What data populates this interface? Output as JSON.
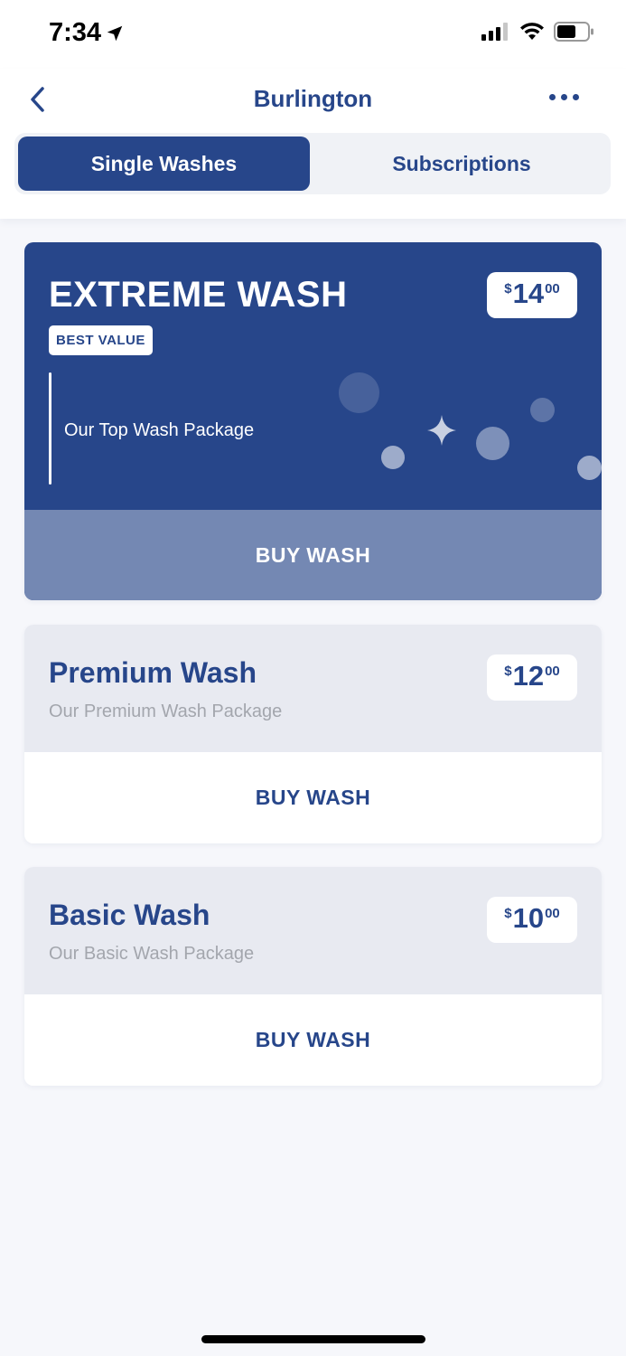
{
  "status_bar": {
    "time": "7:34"
  },
  "header": {
    "title": "Burlington",
    "tabs": [
      {
        "label": "Single Washes",
        "active": true
      },
      {
        "label": "Subscriptions",
        "active": false
      }
    ]
  },
  "washes": [
    {
      "name": "EXTREME WASH",
      "badge": "BEST VALUE",
      "description": "Our Top Wash Package",
      "price": {
        "currency": "$",
        "dollars": "14",
        "cents": "00"
      },
      "button_label": "BUY WASH"
    },
    {
      "name": "Premium Wash",
      "description": "Our Premium Wash Package",
      "price": {
        "currency": "$",
        "dollars": "12",
        "cents": "00"
      },
      "button_label": "BUY WASH"
    },
    {
      "name": "Basic Wash",
      "description": "Our Basic Wash Package",
      "price": {
        "currency": "$",
        "dollars": "10",
        "cents": "00"
      },
      "button_label": "BUY WASH"
    }
  ],
  "colors": {
    "primary": "#27468a",
    "extreme_button": "#7488b3",
    "card_header": "#e8eaf1",
    "background": "#f6f7fb"
  },
  "icons": [
    "location-arrow-icon",
    "cellular-signal-icon",
    "wifi-icon",
    "battery-icon",
    "back-chevron-icon",
    "more-dots-icon",
    "sparkle-icon"
  ]
}
